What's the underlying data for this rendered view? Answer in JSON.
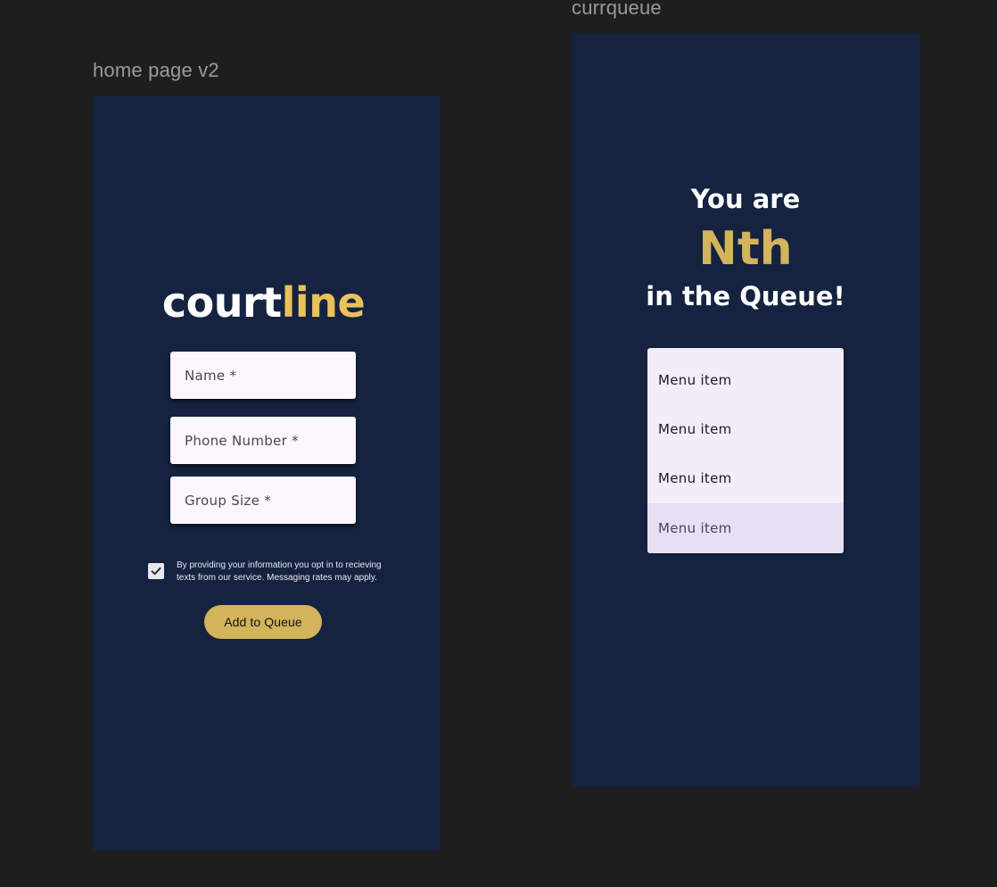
{
  "frames": {
    "home": {
      "label": "home page v2"
    },
    "queue": {
      "label": "currqueue"
    }
  },
  "home": {
    "logo": {
      "part1": "court",
      "part2": "line"
    },
    "fields": {
      "name": {
        "placeholder": "Name *",
        "value": ""
      },
      "phone": {
        "placeholder": "Phone Number *",
        "value": ""
      },
      "group_size": {
        "placeholder": "Group Size *",
        "value": ""
      }
    },
    "optin": {
      "checked": true,
      "text": "By providing your information you opt in to recieving texts from our service. Messaging rates may apply."
    },
    "add_button": {
      "label": "Add to Queue"
    }
  },
  "queue": {
    "line1": "You are",
    "position": "Nth",
    "line3": "in the Queue!",
    "menu_items": [
      {
        "label": "Menu item"
      },
      {
        "label": "Menu item"
      },
      {
        "label": "Menu item"
      },
      {
        "label": "Menu item",
        "selected": true
      }
    ]
  },
  "colors": {
    "canvas_bg": "#1e1e1e",
    "frame_bg": "#152340",
    "accent_gold": "#d3b35c",
    "logo_gold": "#e9c25c",
    "field_bg": "#fcf7fc",
    "menu_bg": "#f3edf7",
    "menu_selected_bg": "#e7dff4"
  },
  "icons": {
    "checkbox": "check-icon"
  }
}
